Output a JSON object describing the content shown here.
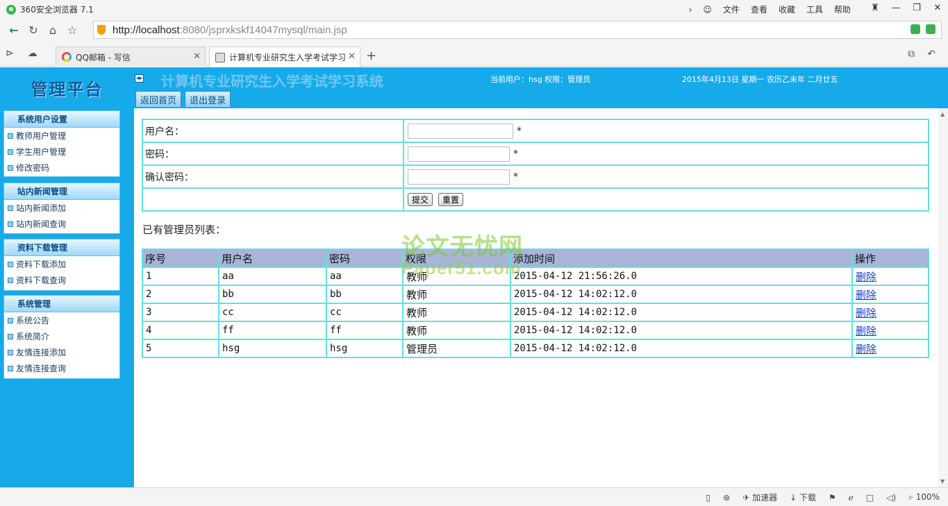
{
  "browser": {
    "app_title": "360安全浏览器 7.1",
    "menus": [
      "文件",
      "查看",
      "收藏",
      "工具",
      "帮助"
    ],
    "url_host": "http://localhost",
    "url_path": ":8080/jsprxkskf14047mysql/main.jsp",
    "tabs": [
      {
        "label": "QQ邮箱 - 写信",
        "active": false
      },
      {
        "label": "计算机专业研究生入学考试学习",
        "active": true
      }
    ],
    "status_items": {
      "accelerator": "加速器",
      "download": "下载",
      "zoom": "100%"
    }
  },
  "header": {
    "brand": "管理平台",
    "system_title": "计算机专业研究生入学考试学习系统",
    "current_user": "当前用户：hsg 权限：管理员",
    "date": "2015年4月13日  星期一  农历乙未年 二月廿五",
    "buttons": {
      "home": "返回首页",
      "logout": "退出登录"
    }
  },
  "sidebar": {
    "groups": [
      {
        "title": "系统用户设置",
        "items": [
          "教师用户管理",
          "学生用户管理",
          "修改密码"
        ]
      },
      {
        "title": "站内新闻管理",
        "items": [
          "站内新闻添加",
          "站内新闻查询"
        ]
      },
      {
        "title": "资料下载管理",
        "items": [
          "资料下载添加",
          "资料下载查询"
        ]
      },
      {
        "title": "系统管理",
        "items": [
          "系统公告",
          "系统简介",
          "友情连接添加",
          "友情连接查询"
        ]
      }
    ]
  },
  "form": {
    "username_label": "用户名：",
    "password_label": "密码：",
    "confirm_label": "确认密码：",
    "username_value": "",
    "password_value": "",
    "confirm_value": "",
    "required_mark": "*",
    "submit_label": "提交",
    "reset_label": "重置"
  },
  "list": {
    "caption": "已有管理员列表：",
    "columns": [
      "序号",
      "用户名",
      "密码",
      "权限",
      "添加时间",
      "操作"
    ],
    "rows": [
      {
        "no": "1",
        "username": "aa",
        "password": "aa",
        "role": "教师",
        "added": "2015-04-12 21:56:26.0",
        "action": "删除"
      },
      {
        "no": "2",
        "username": "bb",
        "password": "bb",
        "role": "教师",
        "added": "2015-04-12 14:02:12.0",
        "action": "删除"
      },
      {
        "no": "3",
        "username": "cc",
        "password": "cc",
        "role": "教师",
        "added": "2015-04-12 14:02:12.0",
        "action": "删除"
      },
      {
        "no": "4",
        "username": "ff",
        "password": "ff",
        "role": "教师",
        "added": "2015-04-12 14:02:12.0",
        "action": "删除"
      },
      {
        "no": "5",
        "username": "hsg",
        "password": "hsg",
        "role": "管理员",
        "added": "2015-04-12 14:02:12.0",
        "action": "删除"
      }
    ]
  },
  "watermark": {
    "cn": "论文无忧网",
    "en": "Paper51.com"
  },
  "colors": {
    "header_bg": "#17aaeb",
    "table_border": "#5fe0e3",
    "table_head_bg": "#a8b5d8",
    "link": "#1a3dc8"
  }
}
